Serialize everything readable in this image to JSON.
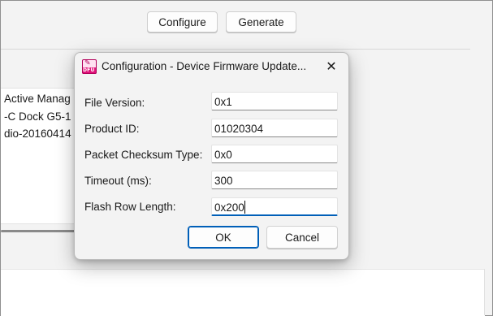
{
  "toolbar": {
    "configure_label": "Configure",
    "generate_label": "Generate"
  },
  "background_list": {
    "items": [
      "Active Manag",
      "-C Dock G5-1",
      "dio-20160414"
    ]
  },
  "dialog": {
    "title": "Configuration - Device Firmware Update...",
    "icon_text": "DFU",
    "close_glyph": "✕",
    "fields": [
      {
        "label": "File Version:",
        "value": "0x1"
      },
      {
        "label": "Product ID:",
        "value": "01020304"
      },
      {
        "label": "Packet Checksum Type:",
        "value": "0x0"
      },
      {
        "label": "Timeout (ms):",
        "value": "300"
      },
      {
        "label": "Flash Row Length:",
        "value": "0x200"
      }
    ],
    "ok_label": "OK",
    "cancel_label": "Cancel"
  },
  "colors": {
    "accent": "#005fb8",
    "icon_pink": "#e0137a"
  }
}
